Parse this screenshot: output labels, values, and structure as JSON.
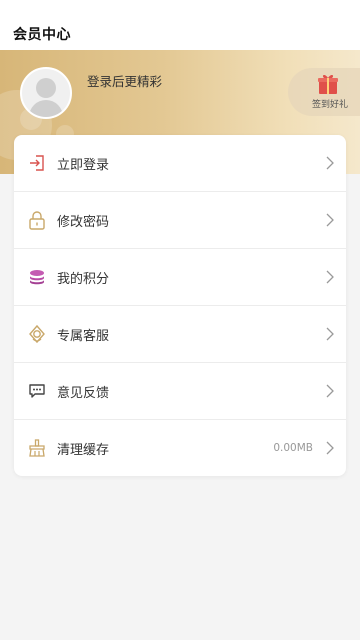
{
  "header": {
    "title": "会员中心"
  },
  "profile": {
    "login_hint": "登录后更精彩",
    "avatar_icon": "user-avatar-icon"
  },
  "signin": {
    "label": "签到好礼",
    "icon": "gift-icon",
    "color": "#e0504a"
  },
  "menu": [
    {
      "key": "login",
      "label": "立即登录",
      "icon": "login-icon",
      "value": ""
    },
    {
      "key": "password",
      "label": "修改密码",
      "icon": "lock-icon",
      "value": ""
    },
    {
      "key": "points",
      "label": "我的积分",
      "icon": "coins-icon",
      "value": ""
    },
    {
      "key": "service",
      "label": "专属客服",
      "icon": "customer-service-icon",
      "value": ""
    },
    {
      "key": "feedback",
      "label": "意见反馈",
      "icon": "chat-bubble-icon",
      "value": ""
    },
    {
      "key": "cache",
      "label": "清理缓存",
      "icon": "broom-icon",
      "value": "0.00MB"
    }
  ],
  "colors": {
    "hero_gradient_start": "#d7b678",
    "hero_gradient_end": "#f5e8cc",
    "gold_icon": "#c9a86a",
    "login_icon": "#d9534f",
    "points_icon": "#b84aa5"
  }
}
